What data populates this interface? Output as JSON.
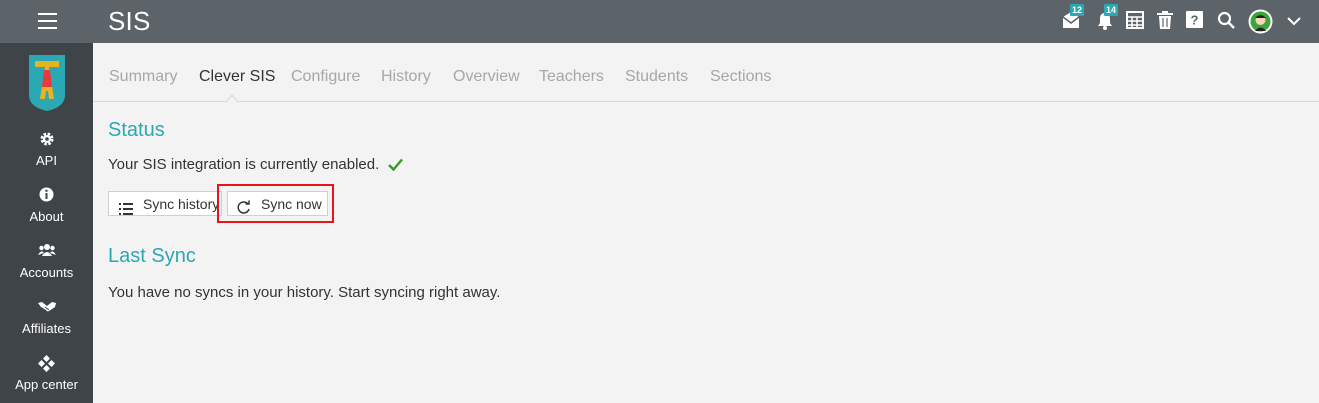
{
  "header": {
    "title": "SIS",
    "messages_badge": "12",
    "notifications_badge": "14",
    "icons": [
      "menu-icon",
      "messages-icon",
      "notifications-icon",
      "calendar-icon",
      "trash-icon",
      "help-icon",
      "search-icon",
      "avatar",
      "chevron-down-icon"
    ]
  },
  "sidebar": {
    "items": [
      {
        "label": "API",
        "icon": "gear-icon"
      },
      {
        "label": "About",
        "icon": "info-icon"
      },
      {
        "label": "Accounts",
        "icon": "users-icon"
      },
      {
        "label": "Affiliates",
        "icon": "handshake-icon"
      },
      {
        "label": "App center",
        "icon": "app-center-icon"
      }
    ]
  },
  "tabs": [
    "Summary",
    "Clever SIS",
    "Configure",
    "History",
    "Overview",
    "Teachers",
    "Students",
    "Sections"
  ],
  "active_tab": "Clever SIS",
  "status": {
    "title": "Status",
    "message": "Your SIS integration is currently enabled.",
    "sync_history_label": "Sync history",
    "sync_now_label": "Sync now"
  },
  "last_sync": {
    "title": "Last Sync",
    "message": "You have no syncs in your history. Start syncing right away."
  },
  "colors": {
    "topbar": "#5c6469",
    "sidebar": "#3f4448",
    "accent": "#2aa8b4",
    "success": "#3a9a2a",
    "highlight": "#e8141a"
  }
}
